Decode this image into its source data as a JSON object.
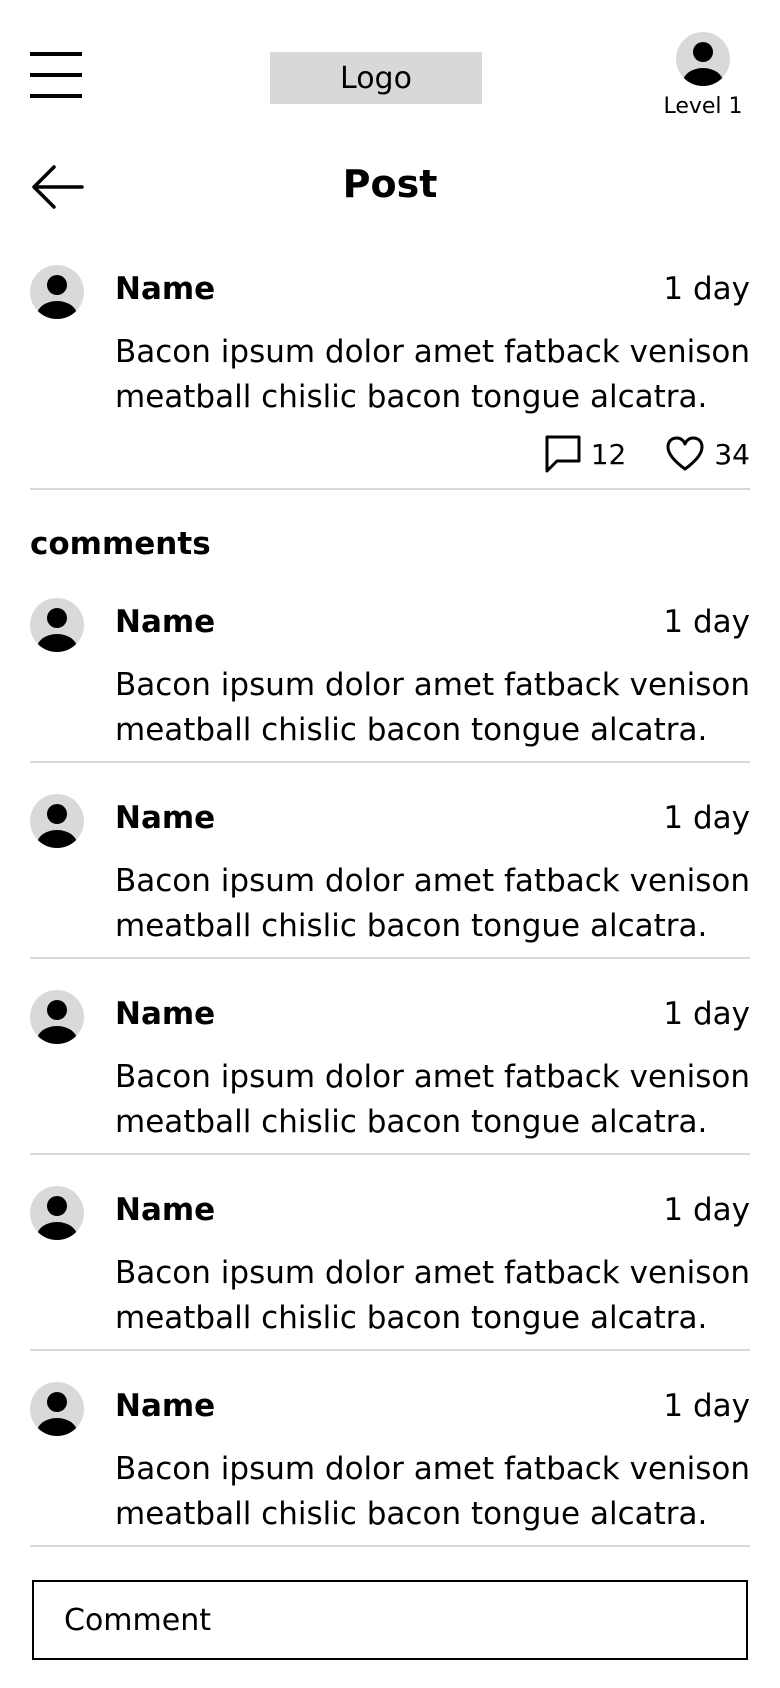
{
  "header": {
    "logo": "Logo",
    "profile_level": "Level 1"
  },
  "page": {
    "title": "Post",
    "comments_heading": "comments"
  },
  "post": {
    "name": "Name",
    "time": "1 day",
    "text": "Bacon ipsum dolor amet fatback venison meatball chislic bacon tongue alcatra.",
    "comment_count": "12",
    "like_count": "34"
  },
  "comments": [
    {
      "name": "Name",
      "time": "1 day",
      "text": "Bacon ipsum dolor amet fatback venison meatball chislic bacon tongue alcatra."
    },
    {
      "name": "Name",
      "time": "1 day",
      "text": "Bacon ipsum dolor amet fatback venison meatball chislic bacon tongue alcatra."
    },
    {
      "name": "Name",
      "time": "1 day",
      "text": "Bacon ipsum dolor amet fatback venison meatball chislic bacon tongue alcatra."
    },
    {
      "name": "Name",
      "time": "1 day",
      "text": "Bacon ipsum dolor amet fatback venison meatball chislic bacon tongue alcatra."
    },
    {
      "name": "Name",
      "time": "1 day",
      "text": "Bacon ipsum dolor amet fatback venison meatball chislic bacon tongue alcatra."
    }
  ],
  "comment_input": {
    "placeholder": "Comment",
    "value": ""
  },
  "icons": {
    "menu": "hamburger-menu-icon",
    "back": "arrow-left-icon",
    "avatar": "user-avatar-icon",
    "comment": "speech-bubble-icon",
    "like": "heart-icon"
  },
  "colors": {
    "avatar_bg": "#d9d9d9",
    "logo_bg": "#d8d8d8",
    "divider": "#d9d9d9",
    "text": "#000000"
  }
}
